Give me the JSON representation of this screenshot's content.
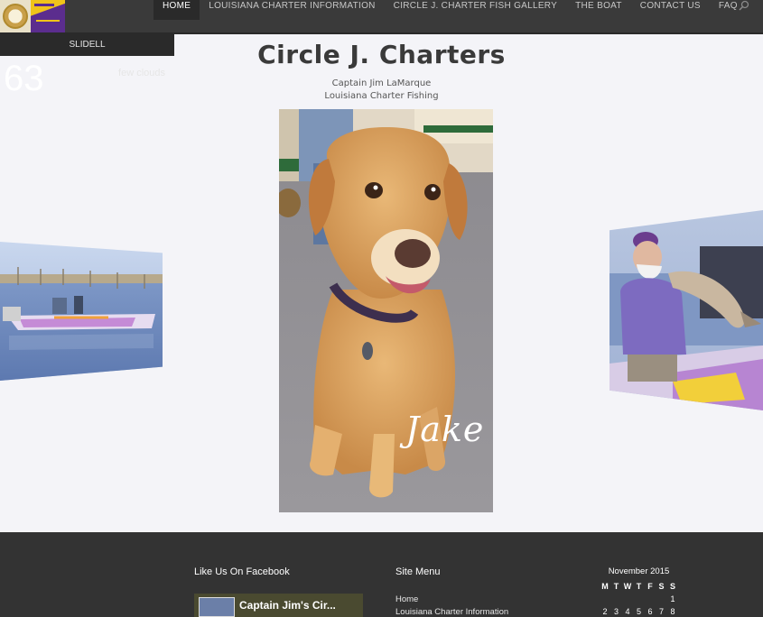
{
  "nav": {
    "items": [
      {
        "label": "HOME",
        "active": true
      },
      {
        "label": "LOUISIANA CHARTER INFORMATION",
        "active": false
      },
      {
        "label": "CIRCLE J. CHARTER FISH GALLERY",
        "active": false
      },
      {
        "label": "THE BOAT",
        "active": false
      },
      {
        "label": "CONTACT US",
        "active": false
      },
      {
        "label": "FAQ",
        "active": false
      }
    ],
    "search_icon": "search-icon"
  },
  "header": {
    "title": "Circle J. Charters",
    "subtitle_line1": "Captain Jim LaMarque",
    "subtitle_line2": "Louisiana Charter Fishing"
  },
  "carousel": {
    "center_caption": "Jake"
  },
  "footer": {
    "weather": {
      "city": "SLIDELL",
      "temp": "63",
      "condition": "few clouds"
    },
    "facebook": {
      "title": "Like Us On Facebook",
      "page_name": "Captain Jim's Cir..."
    },
    "site_menu": {
      "title": "Site Menu",
      "items": [
        "Home",
        "Louisiana Charter Information"
      ]
    },
    "calendar": {
      "month": "November 2015",
      "weekdays": [
        "M",
        "T",
        "W",
        "T",
        "F",
        "S",
        "S"
      ],
      "week1": [
        "",
        "",
        "",
        "",
        "",
        "",
        "1"
      ],
      "week2": [
        "2",
        "3",
        "4",
        "5",
        "6",
        "7",
        "8"
      ]
    }
  },
  "colors": {
    "nav_bg": "#3a3a3a",
    "footer_bg": "#333333",
    "page_bg": "#f4f4f8"
  }
}
